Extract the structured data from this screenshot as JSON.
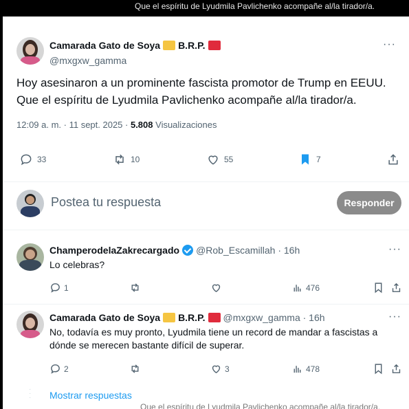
{
  "captions": {
    "top": "Que el espíritu de Lyudmila Pavlichenko acompañe al/la tirador/a.",
    "bottom": "Que el espíritu de Lyudmila Pavlichenko acompañe al/la tirador/a."
  },
  "main_post": {
    "author_name": "Camarada Gato de Soya",
    "author_suffix": "B.R.P.",
    "handle": "@mxgxw_gamma",
    "text_line1": "Hoy asesinaron a un prominente fascista promotor de Trump en EEUU.",
    "text_line2": "Que el espíritu de Lyudmila Pavlichenko acompañe al/la tirador/a.",
    "time": "12:09 a. m. · 11 sept. 2025 · ",
    "views_count": "5.808",
    "views_label": " Visualizaciones",
    "more": "···",
    "replies": "33",
    "reposts": "10",
    "likes": "55",
    "bookmarks": "7"
  },
  "reply_box": {
    "placeholder": "Postea tu respuesta",
    "button": "Responder"
  },
  "comments": [
    {
      "author_name": "ChamperodelaZakrecargado",
      "handle": "@Rob_Escamillah · 16h",
      "text": "Lo celebras?",
      "replies": "1",
      "views": "476",
      "more": "···"
    },
    {
      "author_name": "Camarada Gato de Soya",
      "author_suffix": "B.R.P.",
      "handle": "@mxgxw_gamma · 16h",
      "text": "No, todavía es muy pronto, Lyudmila tiene un record de mandar a fascistas a dónde se merecen bastante difícil de superar.",
      "replies": "2",
      "likes": "3",
      "views": "478",
      "more": "···"
    }
  ],
  "show_more": "Mostrar respuestas",
  "colors": {
    "accent": "#1d9bf0",
    "badge_yellow": "#f5c542",
    "badge_red": "#e02b3c",
    "reply_button": "#8b8b8b"
  }
}
